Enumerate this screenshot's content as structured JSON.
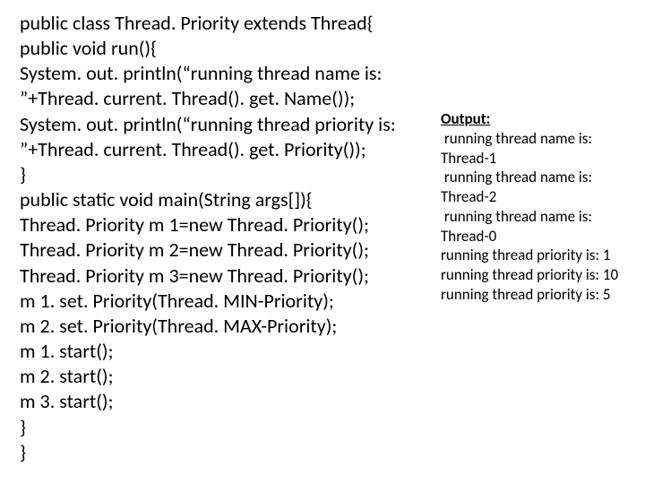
{
  "code": {
    "lines": [
      "public class Thread. Priority extends Thread{",
      "public void run(){",
      "System. out. println(“running thread name is: ”+Thread. current. Thread(). get. Name());",
      "System. out. println(“running thread priority is: ”+Thread. current. Thread(). get. Priority());",
      "}",
      "public static void main(String args[]){",
      "Thread. Priority m 1=new Thread. Priority();",
      "Thread. Priority m 2=new Thread. Priority();",
      "Thread. Priority m 3=new Thread. Priority();",
      "m 1. set. Priority(Thread. MIN-Priority);",
      "m 2. set. Priority(Thread. MAX-Priority);",
      "m 1. start();",
      "m 2. start();",
      "m 3. start();",
      "}",
      "}"
    ]
  },
  "output": {
    "header": "Output:",
    "lines": [
      " running thread name is: Thread-1",
      " running thread name is: Thread-2",
      " running thread name is: Thread-0",
      "running thread priority is: 1",
      "running thread priority is: 10",
      "running thread priority is: 5"
    ]
  }
}
